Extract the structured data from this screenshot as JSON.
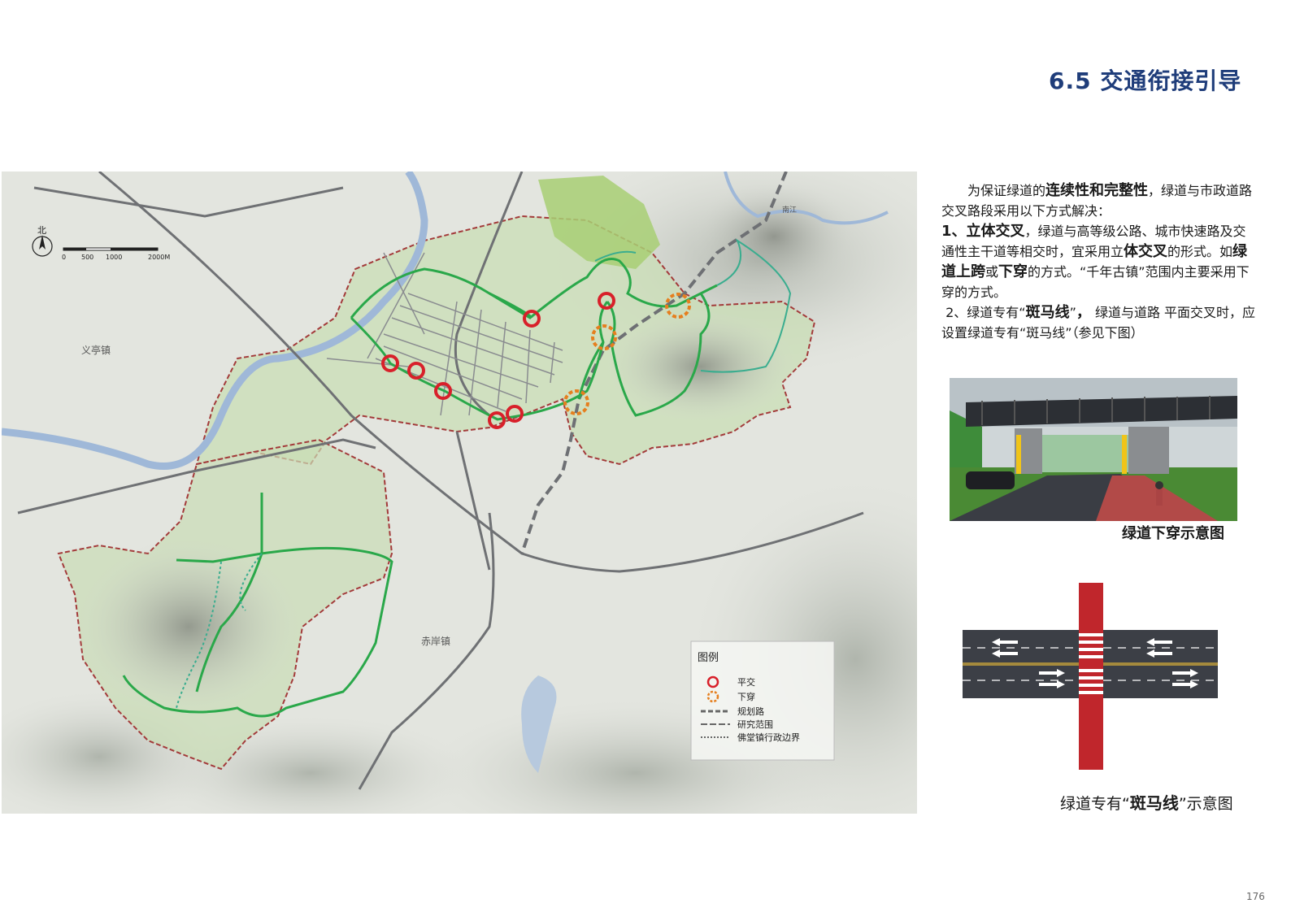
{
  "title": "6.5 交通衔接引导",
  "description": {
    "p1_a": "为保证绿道的",
    "p1_b": "连续性和完整性",
    "p1_c": "，绿道与市政道路交叉路段采用以下方式解决：",
    "p2_a": "1、立体交叉",
    "p2_b": "，绿道与高等级公路、城市快速路及交通性主干道等相交时，宜采用立",
    "p2_c": "体交叉",
    "p2_d": "的形式。如",
    "p2_e": "绿道上跨",
    "p2_f": "或",
    "p2_g": "下穿",
    "p2_h": "的方式。“千年古镇”范围内主要采用下穿的方式。",
    "p3_a": "2、绿道专有“",
    "p3_b": "斑马线",
    "p3_c": "”",
    "p3_d": "，",
    "p3_e": "绿道与道路 平面交叉时，应设置绿道专有“斑马线”（参见下图）"
  },
  "map": {
    "north_label": "北",
    "scale_labels": [
      "0",
      "500",
      "1000",
      "2000M"
    ],
    "place_labels": {
      "yiting": "义亭镇",
      "chian": "赤岸镇",
      "nanjiang": "南江"
    },
    "legend": {
      "title": "图例",
      "items": [
        "平交",
        "下穿",
        "规划路",
        "研究范围",
        "佛堂镇行政边界"
      ]
    }
  },
  "captions": {
    "underpass": "绿道下穿示意图",
    "zebra_a": "绿道专有“",
    "zebra_b": "斑马线",
    "zebra_c": "”示意图"
  },
  "page_number": "176",
  "colors": {
    "title": "#1f3d7a",
    "greenway": "#2aa84a",
    "crossing_level": "#d8202a",
    "crossing_under": "#e57f1f",
    "boundary": "#a33a3a",
    "zebra_band": "#c0262c",
    "road": "#3c3f46"
  }
}
